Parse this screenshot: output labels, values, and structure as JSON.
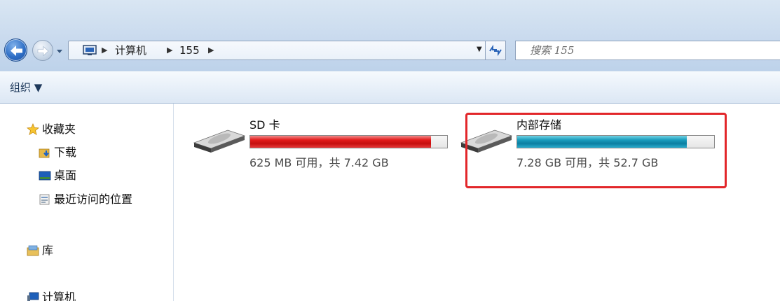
{
  "address_bar": {
    "breadcrumb": [
      "计算机",
      "155"
    ],
    "search_placeholder": "搜索 155"
  },
  "toolbar": {
    "organize_label": "组织 ▼"
  },
  "nav_pane": {
    "items": [
      {
        "label": "收藏夹",
        "icon": "star-icon"
      },
      {
        "label": "下载",
        "icon": "download-folder-icon"
      },
      {
        "label": "桌面",
        "icon": "desktop-icon"
      },
      {
        "label": "最近访问的位置",
        "icon": "recent-places-icon"
      },
      {
        "label": "库",
        "icon": "library-icon"
      },
      {
        "label": "计算机",
        "icon": "computer-icon"
      }
    ]
  },
  "drives": [
    {
      "name": "SD 卡",
      "free_text": "625 MB 可用，共 7.42 GB",
      "used_fraction": 0.918,
      "bar_color": "#d81e1e",
      "icon": "drive-icon"
    },
    {
      "name": "内部存储",
      "free_text": "7.28 GB 可用，共 52.7 GB",
      "used_fraction": 0.862,
      "bar_color": "#168cb0",
      "icon": "drive-icon"
    }
  ],
  "colors": {
    "highlight": "#e2262a",
    "chrome": "#c9daee"
  }
}
